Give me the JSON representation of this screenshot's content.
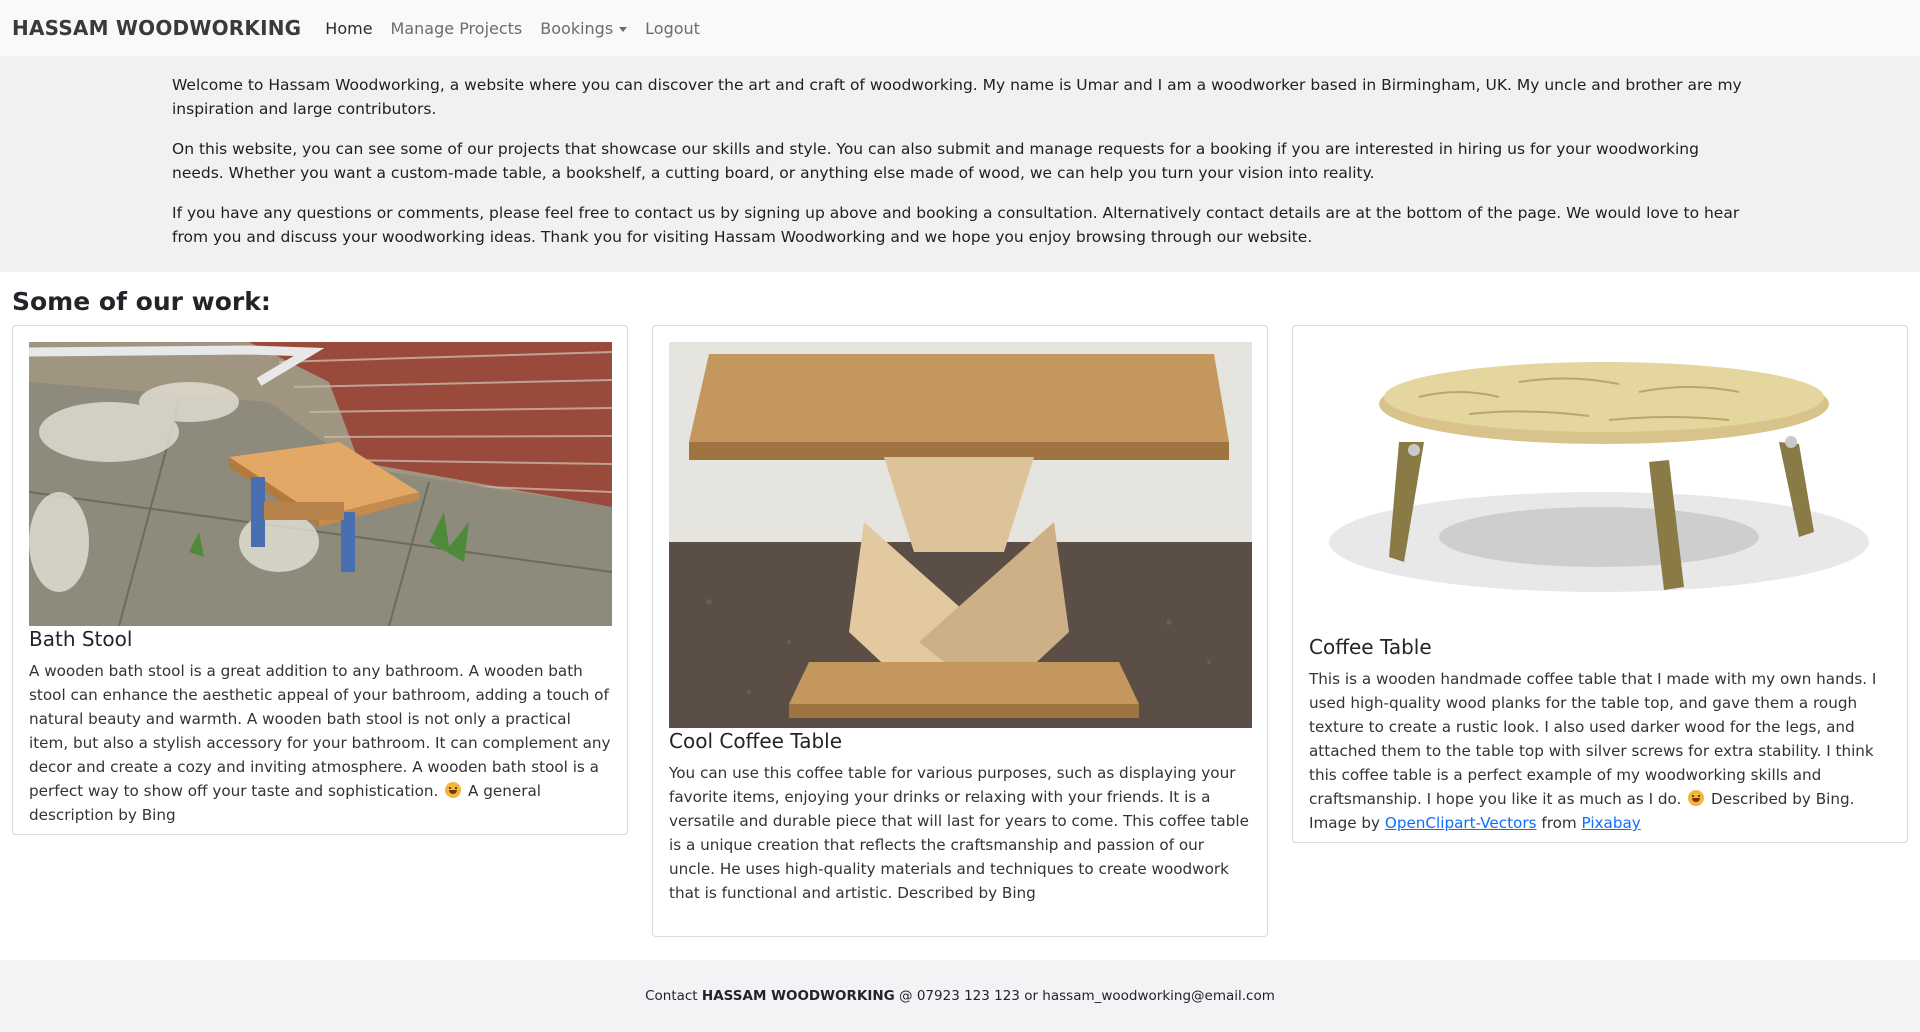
{
  "nav": {
    "brand": "HASSAM WOODWORKING",
    "links": [
      {
        "label": "Home",
        "active": true
      },
      {
        "label": "Manage Projects",
        "active": false
      },
      {
        "label": "Bookings",
        "active": false,
        "dropdown": true
      },
      {
        "label": "Logout",
        "active": false
      }
    ]
  },
  "intro": {
    "paragraphs": [
      "Welcome to Hassam Woodworking, a website where you can discover the art and craft of woodworking. My name is Umar and I am a woodworker based in Birmingham, UK. My uncle and brother are my inspiration and large contributors.",
      "On this website, you can see some of our projects that showcase our skills and style. You can also submit and manage requests for a booking if you are interested in hiring us for your woodworking needs. Whether you want a custom-made table, a bookshelf, a cutting board, or anything else made of wood, we can help you turn your vision into reality.",
      "If you have any questions or comments, please feel free to contact us by signing up above and booking a consultation. Alternatively contact details are at the bottom of the page. We would love to hear from you and discuss your woodworking ideas. Thank you for visiting Hassam Woodworking and we hope you enjoy browsing through our website."
    ]
  },
  "section_title": "Some of our work:",
  "projects": [
    {
      "title": "Bath Stool",
      "text": "A wooden bath stool is a great addition to any bathroom. A wooden bath stool can enhance the aesthetic appeal of your bathroom, adding a touch of natural beauty and warmth. A wooden bath stool is not only a practical item, but also a stylish accessory for your bathroom. It can complement any decor and create a cozy and inviting atmosphere. A wooden bath stool is a perfect way to show off your taste and sophistication.",
      "suffix": "A general description by Bing"
    },
    {
      "title": "Cool Coffee Table",
      "text": "You can use this coffee table for various purposes, such as displaying your favorite items, enjoying your drinks or relaxing with your friends. It is a versatile and durable piece that will last for years to come. This coffee table is a unique creation that reflects the craftsmanship and passion of our uncle. He uses high-quality materials and techniques to create woodwork that is functional and artistic. Described by Bing"
    },
    {
      "title": "Coffee Table",
      "text": "This is a wooden handmade coffee table that I made with my own hands. I used high-quality wood planks for the table top, and gave them a rough texture to create a rustic look. I also used darker wood for the legs, and attached them to the table top with silver screws for extra stability. I think this coffee table is a perfect example of my woodworking skills and craftsmanship. I hope you like it as much as I do.",
      "suffix_pre": "Described by Bing. Image by",
      "link1": "OpenClipart-Vectors",
      "mid": "from",
      "link2": "Pixabay"
    }
  ],
  "footer": {
    "pre": "Contact",
    "brand": "HASSAM WOODWORKING",
    "post": "@ 07923 123 123 or hassam_woodworking@email.com"
  },
  "colors": {
    "navbar_bg": "#f8f9fa",
    "intro_bg": "#f2f1ef",
    "footer_bg": "#f3f3f5",
    "link": "#0d6efd"
  }
}
